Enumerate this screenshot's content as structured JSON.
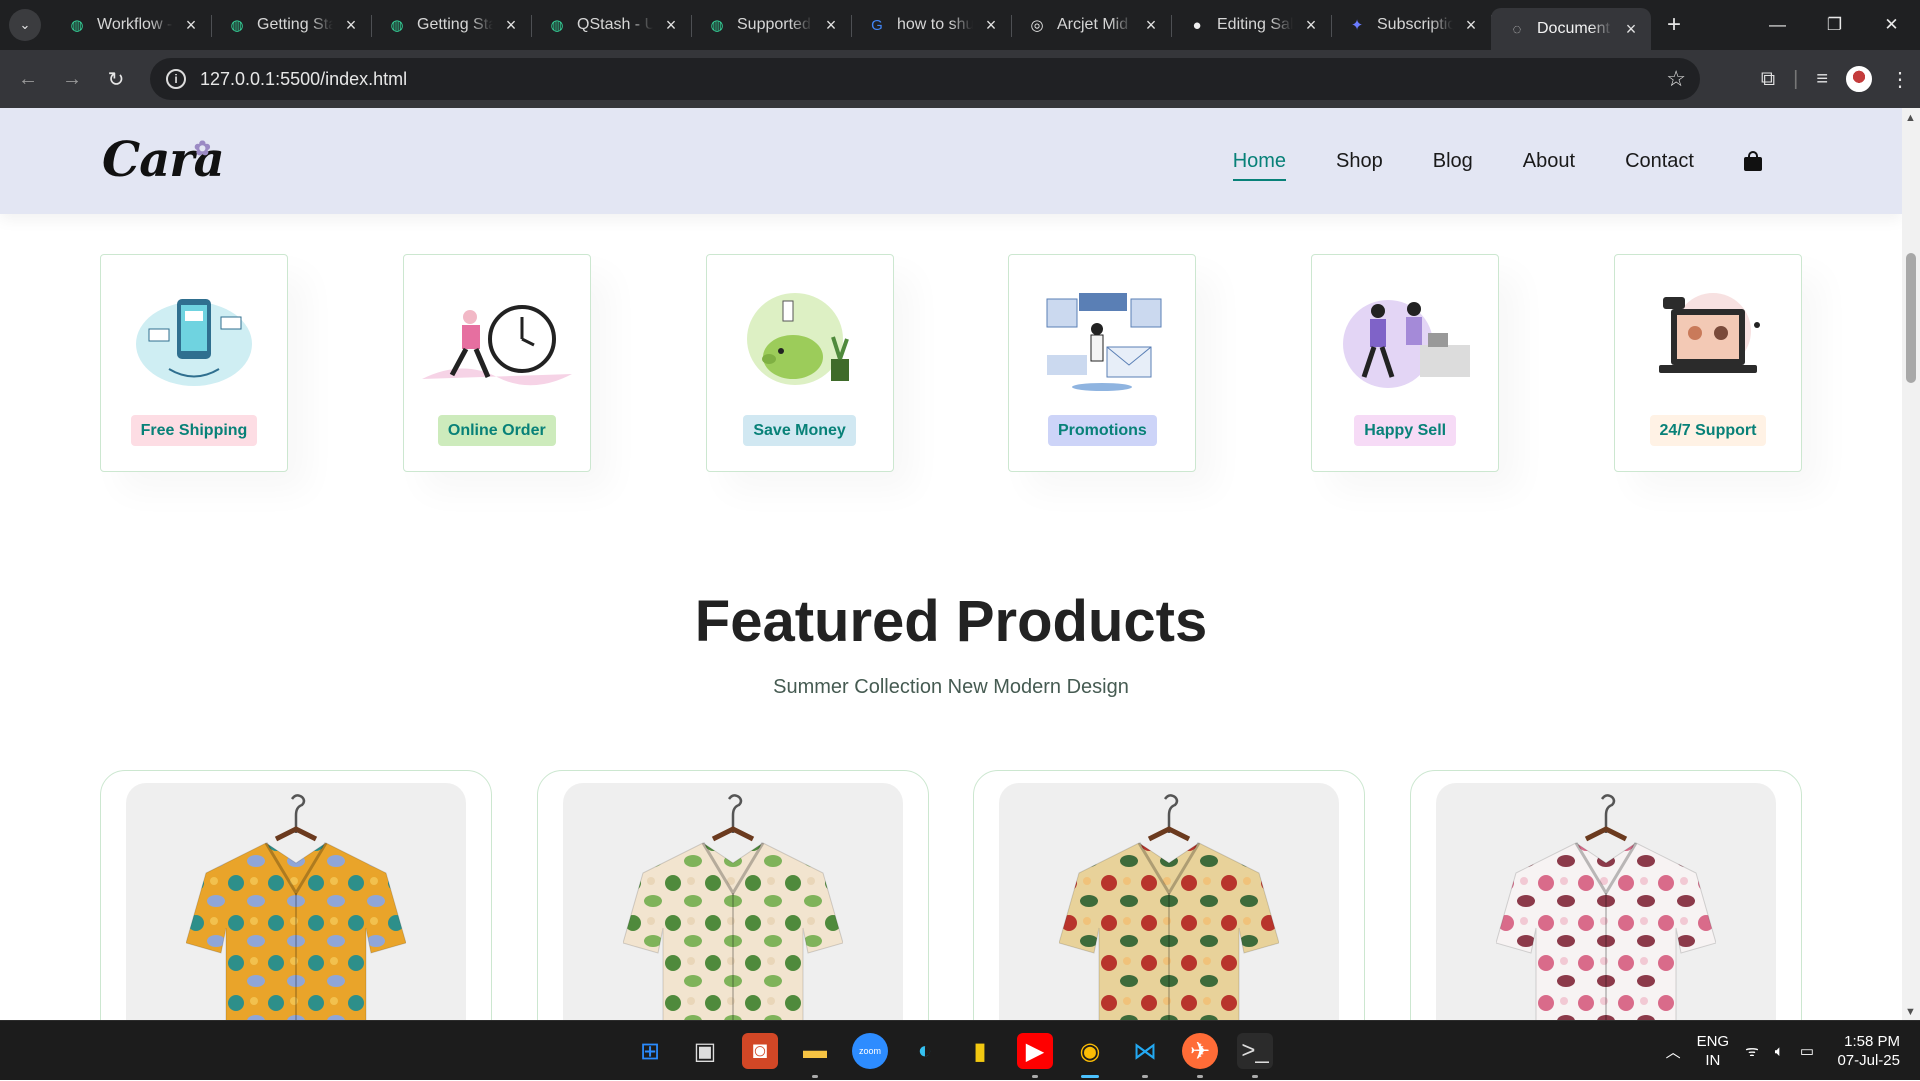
{
  "browser": {
    "tabs": [
      {
        "title": "Workflow - ",
        "icon": "upstash-icon",
        "active": false
      },
      {
        "title": "Getting Sta",
        "icon": "upstash-icon",
        "active": false
      },
      {
        "title": "Getting Sta",
        "icon": "upstash-icon",
        "active": false
      },
      {
        "title": "QStash - U",
        "icon": "upstash-icon",
        "active": false
      },
      {
        "title": "Supported",
        "icon": "upstash-icon",
        "active": false
      },
      {
        "title": "how to shu",
        "icon": "google-icon",
        "active": false
      },
      {
        "title": "Arcjet Mid",
        "icon": "arcjet-icon",
        "active": false
      },
      {
        "title": "Editing Sal",
        "icon": "github-icon",
        "active": false
      },
      {
        "title": "Subscriptio",
        "icon": "extension-icon",
        "active": false
      },
      {
        "title": "Document",
        "icon": "globe-icon",
        "active": true
      }
    ],
    "url": "127.0.0.1:5500/index.html"
  },
  "site": {
    "logo": "Cara",
    "nav": [
      "Home",
      "Shop",
      "Blog",
      "About",
      "Contact"
    ],
    "active_nav": "Home",
    "features": [
      {
        "label": "Free Shipping",
        "bg": "#fddde4",
        "art": "phone-delivery"
      },
      {
        "label": "Online Order",
        "bg": "#cdebbc",
        "art": "clock-runner"
      },
      {
        "label": "Save Money",
        "bg": "#d1e8f2",
        "art": "piggy-bank"
      },
      {
        "label": "Promotions",
        "bg": "#cdd4f8",
        "art": "mail-promo"
      },
      {
        "label": "Happy Sell",
        "bg": "#f6dbf6",
        "art": "high-five"
      },
      {
        "label": "24/7 Support",
        "bg": "#fff2e5",
        "art": "laptop-support"
      }
    ],
    "featured": {
      "title": "Featured Products",
      "subtitle": "Summer Collection New Modern Design"
    },
    "products": [
      {
        "name": "abstract-print-shirt",
        "colors": [
          "#e9a42a",
          "#2d8f8a",
          "#8fa6d8",
          "#f2c14e"
        ]
      },
      {
        "name": "tropical-leaf-shirt",
        "colors": [
          "#f2e4cf",
          "#4f8a3c",
          "#7fb35a",
          "#e9d6b8"
        ]
      },
      {
        "name": "floral-red-shirt",
        "colors": [
          "#e8d29a",
          "#b8342c",
          "#3d6b3a",
          "#f0c27a"
        ]
      },
      {
        "name": "cherry-blossom-shirt",
        "colors": [
          "#f7f3f3",
          "#d96b8a",
          "#8c3a4a",
          "#f2c9d4"
        ]
      }
    ]
  },
  "taskbar": {
    "apps": [
      "start-icon",
      "task-view-icon",
      "office-icon",
      "file-explorer-icon",
      "zoom-icon",
      "edge-icon",
      "power-bi-icon",
      "youtube-icon",
      "chrome-icon",
      "vscode-icon",
      "postman-icon",
      "terminal-icon"
    ],
    "lang_top": "ENG",
    "lang_bottom": "IN",
    "time": "1:58 PM",
    "date": "07-Jul-25"
  }
}
